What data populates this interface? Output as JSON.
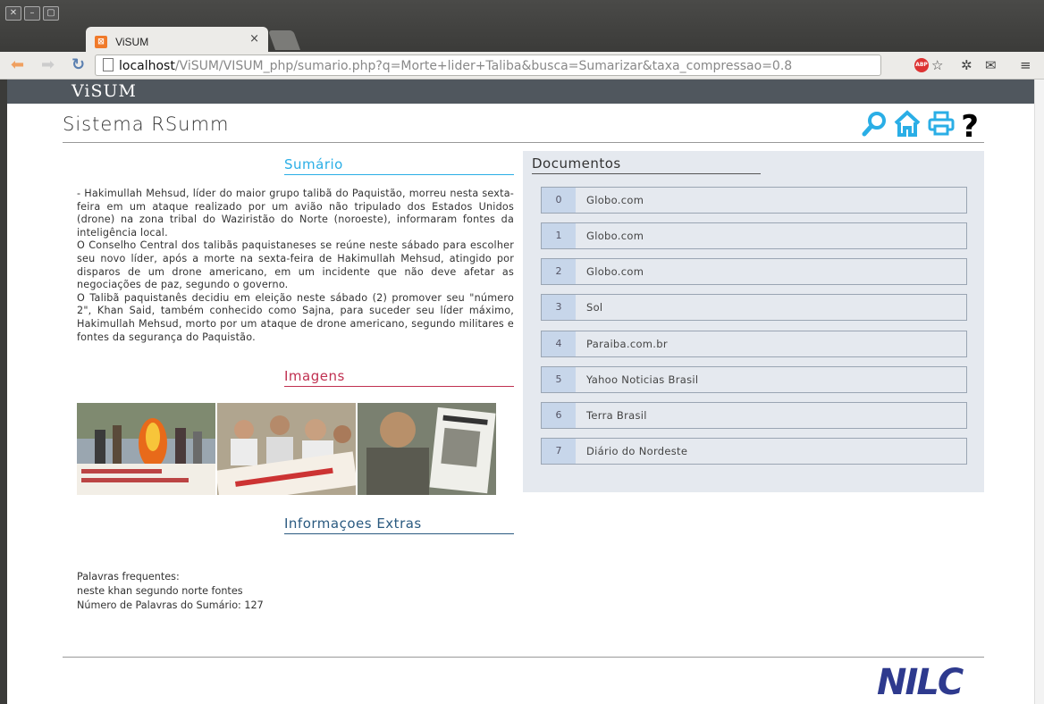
{
  "browser": {
    "tab_title": "ViSUM",
    "tab_close": "×",
    "url_host": "localhost",
    "url_path": "/ViSUM/VISUM_php/sumario.php?q=Morte+lider+Taliba&busca=Sumarizar&taxa_compressao=0.8",
    "abp_label": "ABP"
  },
  "site": {
    "brand": "ViSUM",
    "title": "Sistema RSumm",
    "logo": "NILC"
  },
  "sections": {
    "summary_title": "Sumário",
    "images_title": "Imagens",
    "extras_title": "Informaçoes Extras",
    "docs_title": "Documentos"
  },
  "summary": [
    "- Hakimullah Mehsud, líder do maior grupo talibã do Paquistão, morreu nesta sexta-feira em um ataque realizado por um avião não tripulado dos Estados Unidos (drone) na zona tribal do Waziristão do Norte (noroeste), informaram fontes da inteligência local.",
    "O Conselho Central dos talibãs paquistaneses se reúne neste sábado para escolher seu novo líder, após a morte na sexta-feira de Hakimullah Mehsud, atingido por disparos de um drone americano, em um incidente que não deve afetar as negociações de paz, segundo o governo.",
    "O Talibã paquistanês decidiu em eleição neste sábado (2) promover seu \"número 2\", Khan Said, também conhecido como Sajna, para suceder seu líder máximo, Hakimullah Mehsud, morto por um ataque de drone americano, segundo militares e fontes da segurança do Paquistão."
  ],
  "extras": {
    "freq_label": "Palavras frequentes:",
    "freq_words": "neste khan segundo norte fontes",
    "word_count": "Número de Palavras do Sumário: 127"
  },
  "documents": [
    {
      "idx": "0",
      "name": "Globo.com"
    },
    {
      "idx": "1",
      "name": "Globo.com"
    },
    {
      "idx": "2",
      "name": "Globo.com"
    },
    {
      "idx": "3",
      "name": "Sol"
    },
    {
      "idx": "4",
      "name": "Paraiba.com.br"
    },
    {
      "idx": "5",
      "name": "Yahoo Noticias Brasil"
    },
    {
      "idx": "6",
      "name": "Terra Brasil"
    },
    {
      "idx": "7",
      "name": "Diário do Nordeste"
    }
  ],
  "icons": [
    "search-icon",
    "home-icon",
    "print-icon",
    "help-icon"
  ],
  "colors": {
    "accent": "#2aaee6",
    "topbar": "#50575e",
    "docs_bg": "#e5e9ef"
  }
}
